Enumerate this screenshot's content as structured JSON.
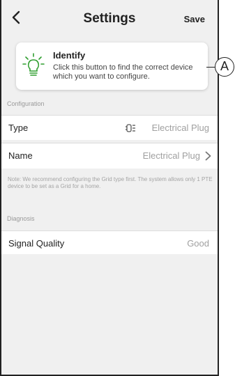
{
  "header": {
    "title": "Settings",
    "save_label": "Save",
    "back_icon": "back-chevron-icon"
  },
  "identify": {
    "title": "Identify",
    "description": "Click this button to find the correct device which you want to configure.",
    "icon": "lightbulb-icon",
    "accent_color": "#2f9e2f"
  },
  "configuration": {
    "section_label": "Configuration",
    "type": {
      "label": "Type",
      "value": "Electrical Plug",
      "icon": "plug-icon"
    },
    "name": {
      "label": "Name",
      "value": "Electrical Plug",
      "icon": "chevron-right-icon"
    }
  },
  "note": "Note: We recommend configuring the Grid type first. The system allows only 1 PTE device to be set as a Grid for a home.",
  "diagnosis": {
    "section_label": "Diagnosis",
    "signal": {
      "label": "Signal Quality",
      "value": "Good"
    }
  },
  "callout": {
    "label": "A"
  }
}
